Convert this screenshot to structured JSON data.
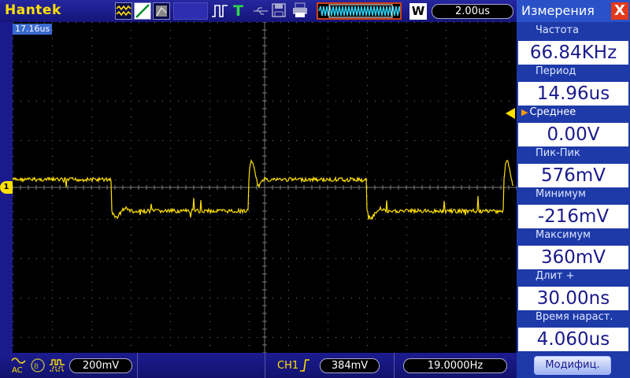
{
  "header": {
    "brand": "Hantek",
    "trigger_mode_label": "T",
    "wave_mode_label": "W",
    "timebase": "2.00us"
  },
  "screen": {
    "trigger_position": "17.16us",
    "channel_marker": "1"
  },
  "footer": {
    "ch1_volts_div": "200mV",
    "trigger_channel": "CH1",
    "trigger_level": "384mV",
    "trigger_frequency": "19.0000Hz"
  },
  "panel": {
    "title": "Измерения",
    "close_symbol": "X",
    "measurements": [
      {
        "label": "Частота",
        "value": "66.84KHz"
      },
      {
        "label": "Период",
        "value": "14.96us"
      },
      {
        "label": "Среднее",
        "value": "0.00V"
      },
      {
        "label": "Пик-Пик",
        "value": "576mV"
      },
      {
        "label": "Минимум",
        "value": "-216mV"
      },
      {
        "label": "Максимум",
        "value": "360mV"
      },
      {
        "label": "Длит +",
        "value": "30.00ns"
      },
      {
        "label": "Время нараст.",
        "value": "4.060us"
      }
    ],
    "modify_button": "Модифиц."
  },
  "colors": {
    "trace": "#ffe000",
    "panel_bg": "#1e3aa8",
    "screen_bg": "#000000",
    "accent": "#e23a1a"
  },
  "waveform": {
    "volts_per_div": 0.2,
    "time_per_div_us": 2.0,
    "high_level_v": 0.04,
    "low_level_v": -0.12
  }
}
